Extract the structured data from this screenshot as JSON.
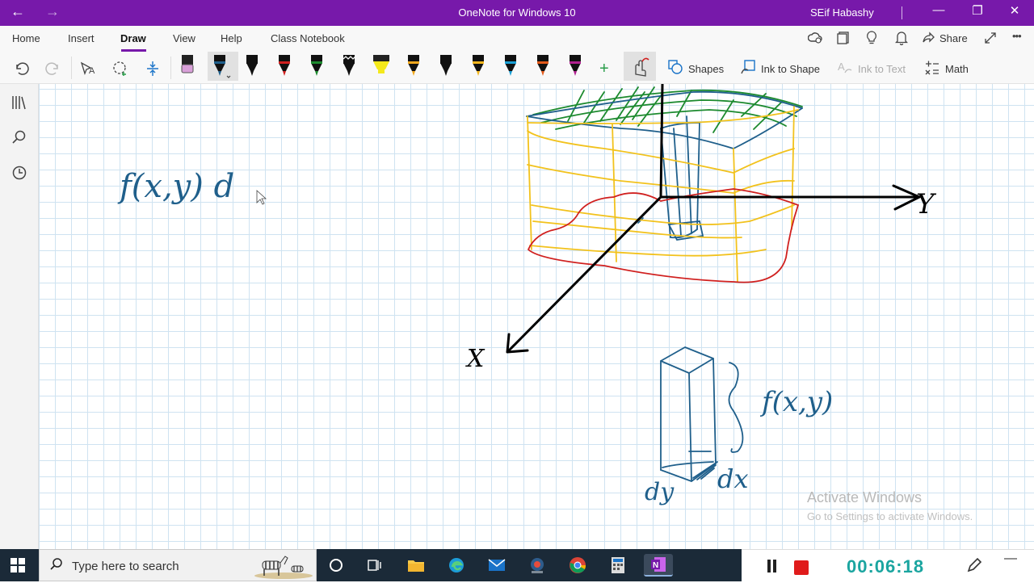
{
  "window": {
    "title": "OneNote for Windows 10",
    "user": "SEif Habashy",
    "back_label": "←",
    "forward_label": "→",
    "minimize_label": "—",
    "restore_label": "❐",
    "close_label": "✕"
  },
  "ribbon": {
    "tabs": [
      {
        "label": "Home"
      },
      {
        "label": "Insert"
      },
      {
        "label": "Draw",
        "active": true
      },
      {
        "label": "View"
      },
      {
        "label": "Help"
      },
      {
        "label": "Class Notebook"
      }
    ],
    "share_label": "Share",
    "more_label": "•••",
    "tools": {
      "shapes": "Shapes",
      "ink_to_shape": "Ink to Shape",
      "ink_to_text": "Ink to Text",
      "math": "Math",
      "add_pen": "+"
    },
    "pens": [
      {
        "kind": "eraser",
        "color": "#d9a0d9"
      },
      {
        "kind": "pen",
        "color": "#1f5f8b",
        "selected": true
      },
      {
        "kind": "pen",
        "color": "#111111"
      },
      {
        "kind": "pen",
        "color": "#d0201f"
      },
      {
        "kind": "pen",
        "color": "#1c8a2e"
      },
      {
        "kind": "pen",
        "color": "#111111",
        "pattern": "zigzag"
      },
      {
        "kind": "highlighter",
        "color": "#f4e91c"
      },
      {
        "kind": "pen",
        "color": "#f2a81d"
      },
      {
        "kind": "pen",
        "color": "#111111"
      },
      {
        "kind": "pen",
        "color": "#f2b51d"
      },
      {
        "kind": "pen",
        "color": "#1aa0d6"
      },
      {
        "kind": "pen",
        "color": "#e35a1a"
      },
      {
        "kind": "pen",
        "color": "#b0208f"
      }
    ]
  },
  "sidebar": {
    "icons": [
      "notebooks-icon",
      "search-icon",
      "recent-icon"
    ]
  },
  "canvas": {
    "ink_labels": {
      "fxy_left": "f(x,y) d",
      "axis_y": "Y",
      "axis_x": "X",
      "fxy_right": "f(x,y)",
      "dx": "dx",
      "dy": "dy"
    },
    "ink_colors": {
      "blue": "#1f5f8b",
      "black": "#000000",
      "red": "#d0201f",
      "green": "#1c8a2e",
      "yellow": "#f2c21d"
    },
    "watermark_title": "Activate Windows",
    "watermark_sub": "Go to Settings to activate Windows."
  },
  "taskbar": {
    "search_placeholder": "Type here to search",
    "apps": [
      "cortana-icon",
      "task-view-icon",
      "file-explorer-icon",
      "edge-icon",
      "mail-icon",
      "webcam-icon",
      "chrome-icon",
      "calculator-icon",
      "onenote-icon"
    ]
  },
  "recorder": {
    "timer": "00:06:18",
    "minimize_label": "—"
  }
}
